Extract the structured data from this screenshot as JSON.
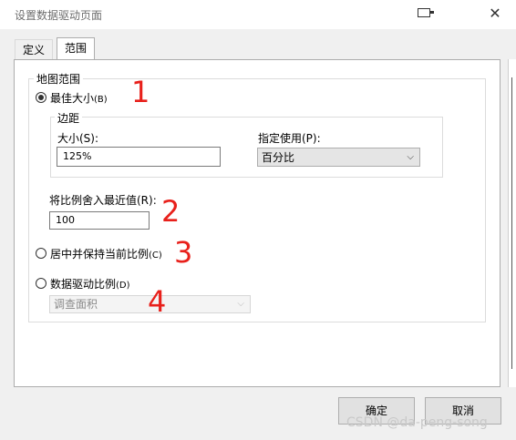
{
  "window": {
    "title": "设置数据驱动页面"
  },
  "tabs": [
    {
      "label": "定义",
      "active": false
    },
    {
      "label": "范围",
      "active": true
    }
  ],
  "extent": {
    "group_label": "地图范围",
    "best_fit": {
      "label": "最佳大小",
      "hotkey": "(B)",
      "selected": true,
      "margin": {
        "group_label": "边距",
        "size_label": "大小(S):",
        "size_value": "125%",
        "units_label": "指定使用(P):",
        "units_value": "百分比"
      }
    },
    "round_scale": {
      "label": "将比例舍入最近值(R):",
      "value": "100"
    },
    "center_keep_scale": {
      "label": "居中并保持当前比例",
      "hotkey": "(C)",
      "selected": false
    },
    "data_driven_scale": {
      "label": "数据驱动比例",
      "hotkey": "(D)",
      "selected": false,
      "field_value": "调查面积"
    }
  },
  "annotations": [
    "1",
    "2",
    "3",
    "4"
  ],
  "buttons": {
    "ok": "确定",
    "cancel": "取消"
  },
  "watermark": "CSDN @da-peng-song",
  "colors": {
    "annotation": "#e8201b",
    "dialog_bg": "#f0f0f0"
  }
}
